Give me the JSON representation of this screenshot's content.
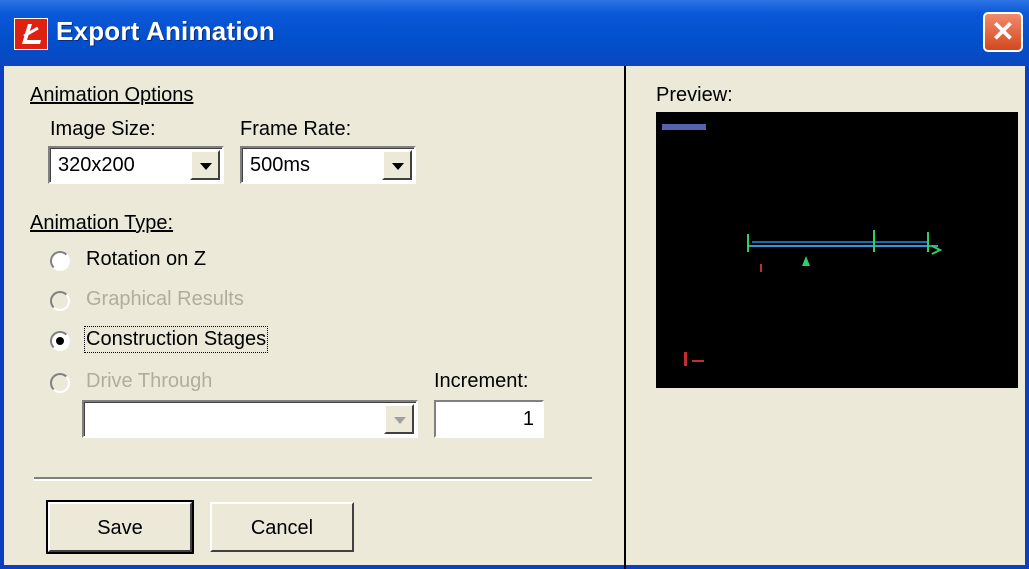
{
  "window": {
    "title": "Export Animation",
    "close_glyph": "✕"
  },
  "options": {
    "heading": "Animation Options",
    "image_size_label": "Image Size:",
    "image_size_value": "320x200",
    "frame_rate_label": "Frame Rate:",
    "frame_rate_value": "500ms"
  },
  "animation_type": {
    "heading": "Animation Type:",
    "options": [
      {
        "label": "Rotation on Z",
        "checked": false,
        "enabled": true
      },
      {
        "label": "Graphical Results",
        "checked": false,
        "enabled": false
      },
      {
        "label": "Construction Stages",
        "checked": true,
        "enabled": true
      },
      {
        "label": "Drive Through",
        "checked": false,
        "enabled": false
      }
    ],
    "increment_label": "Increment:",
    "increment_value": "1",
    "drive_through_value": ""
  },
  "buttons": {
    "save": "Save",
    "cancel": "Cancel"
  },
  "preview": {
    "label": "Preview:"
  },
  "colors": {
    "title_bar": "#0250cc",
    "face": "#ece9d8",
    "close": "#d4481e",
    "preview_bg": "#000000"
  }
}
